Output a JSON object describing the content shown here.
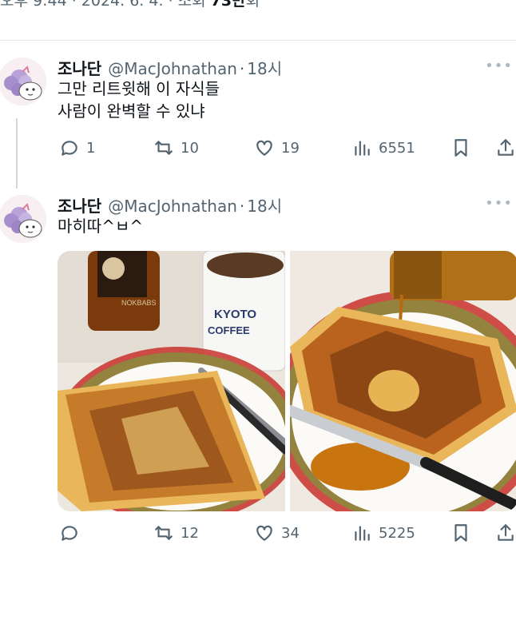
{
  "top_meta": {
    "prefix": "오후 9:44 · 2024. 6. 4. · 조회 ",
    "views": "73만",
    "suffix": "회"
  },
  "tweets": [
    {
      "name": "조나단",
      "handle": "@MacJohnathan",
      "time": "18시",
      "lines": [
        "그만 리트윗해 이 자식들",
        "사람이 완벽할 수 있냐"
      ],
      "replies": "1",
      "retweets": "10",
      "likes": "19",
      "views": "6551"
    },
    {
      "name": "조나단",
      "handle": "@MacJohnathan",
      "time": "18시",
      "lines": [
        "마히따^ㅂ^"
      ],
      "replies": "",
      "retweets": "12",
      "likes": "34",
      "views": "5225"
    }
  ],
  "media_text": {
    "mug_brand": "KYOTO",
    "mug_sub": "COFFEE",
    "syrup_label": "NOKBABS"
  },
  "colors": {
    "text": "#0f1419",
    "muted": "#536471",
    "divider": "#e6e9ec"
  },
  "icons": [
    "reply-icon",
    "retweet-icon",
    "like-icon",
    "views-icon",
    "bookmark-icon",
    "share-icon",
    "more-icon"
  ]
}
